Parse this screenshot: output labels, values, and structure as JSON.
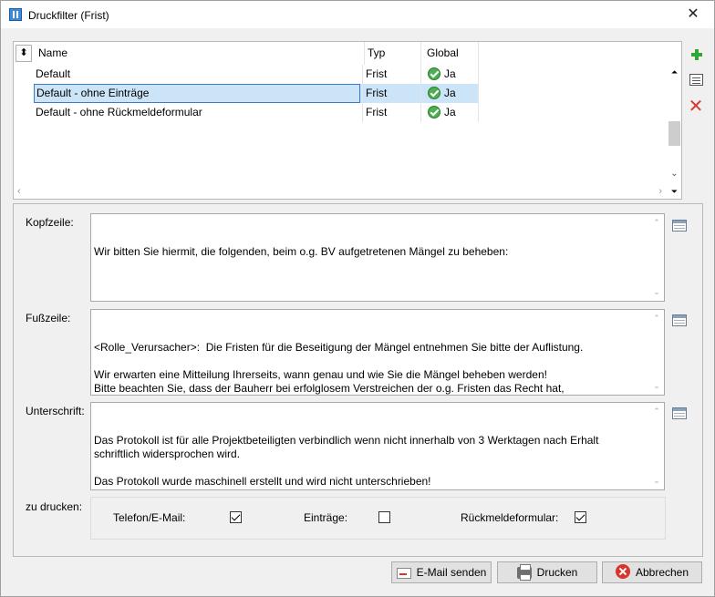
{
  "window": {
    "title": "Druckfilter  (Frist)",
    "close_glyph": "✕"
  },
  "grid": {
    "columns": {
      "name": "Name",
      "typ": "Typ",
      "global": "Global"
    },
    "sort_glyph": "⬍",
    "rows": [
      {
        "name": "Default",
        "typ": "Frist",
        "global": "Ja",
        "selected": false
      },
      {
        "name": "Default - ohne Einträge",
        "typ": "Frist",
        "global": "Ja",
        "selected": true
      },
      {
        "name": "Default - ohne Rückmeldeformular",
        "typ": "Frist",
        "global": "Ja",
        "selected": false
      }
    ]
  },
  "form": {
    "kopfzeile": {
      "label": "Kopfzeile:",
      "text": "Wir bitten Sie hiermit, die folgenden, beim o.g. BV aufgetretenen Mängel zu beheben:"
    },
    "fusszeile": {
      "label": "Fußzeile:",
      "text": "<Rolle_Verursacher>:  Die Fristen für die Beseitigung der Mängel entnehmen Sie bitte der Auflistung.\n\nWir erwarten eine Mitteilung Ihrerseits, wann genau und wie Sie die Mängel beheben werden!\nBitte beachten Sie, dass der Bauherr bei erfolglosem Verstreichen der o.g. Fristen das Recht hat,\nohne weitere Ankündigung einen anderen Handwerker mit der Mängelbeseitigung zu beauftragen."
    },
    "unterschrift": {
      "label": "Unterschrift:",
      "text": "Das Protokoll ist für alle Projektbeteiligten verbindlich wenn nicht innerhalb von 3 Werktagen nach Erhalt schriftlich widersprochen wird.\n\nDas Protokoll wurde maschinell erstellt und wird nicht unterschrieben!"
    },
    "zu_drucken": {
      "label": "zu drucken:",
      "options": [
        {
          "label": "Telefon/E-Mail:",
          "checked": true
        },
        {
          "label": "Einträge:",
          "checked": false
        },
        {
          "label": "Rückmeldeformular:",
          "checked": true
        }
      ]
    }
  },
  "buttons": {
    "email": "E-Mail senden",
    "print": "Drucken",
    "cancel": "Abbrechen"
  }
}
